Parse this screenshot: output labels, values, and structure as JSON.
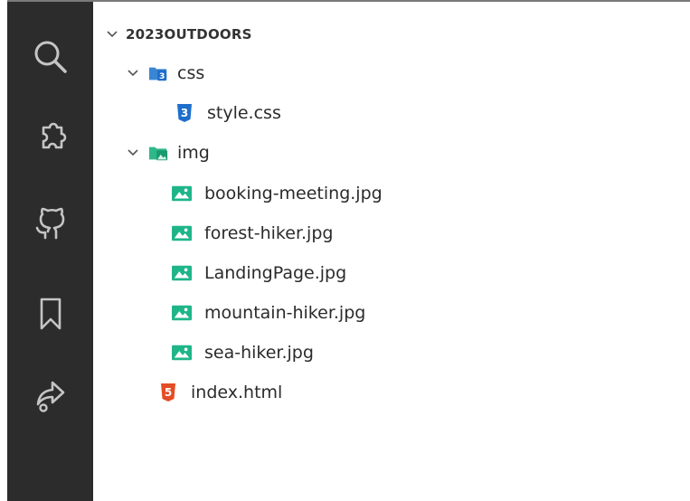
{
  "activity_bar": {
    "icons": [
      "search-icon",
      "extensions-icon",
      "github-icon",
      "bookmark-icon",
      "live-share-icon"
    ]
  },
  "explorer": {
    "root": {
      "label": "2023OUTDOORS",
      "expanded": true
    },
    "folders": {
      "css": {
        "label": "css",
        "expanded": true
      },
      "img": {
        "label": "img",
        "expanded": true
      }
    },
    "files": {
      "style_css": "style.css",
      "booking_meeting": "booking-meeting.jpg",
      "forest_hiker": "forest-hiker.jpg",
      "landing_page": "LandingPage.jpg",
      "mountain_hiker": "mountain-hiker.jpg",
      "sea_hiker": "sea-hiker.jpg",
      "index_html": "index.html"
    }
  },
  "colors": {
    "activity_bar_bg": "#2c2c2c",
    "activity_icon": "#c5c5c5",
    "css_icon": "#1e6fcc",
    "image_icon": "#1fb589",
    "html_icon": "#e44d26",
    "folder_css": "#3a86d4",
    "folder_img": "#2fb88a"
  }
}
